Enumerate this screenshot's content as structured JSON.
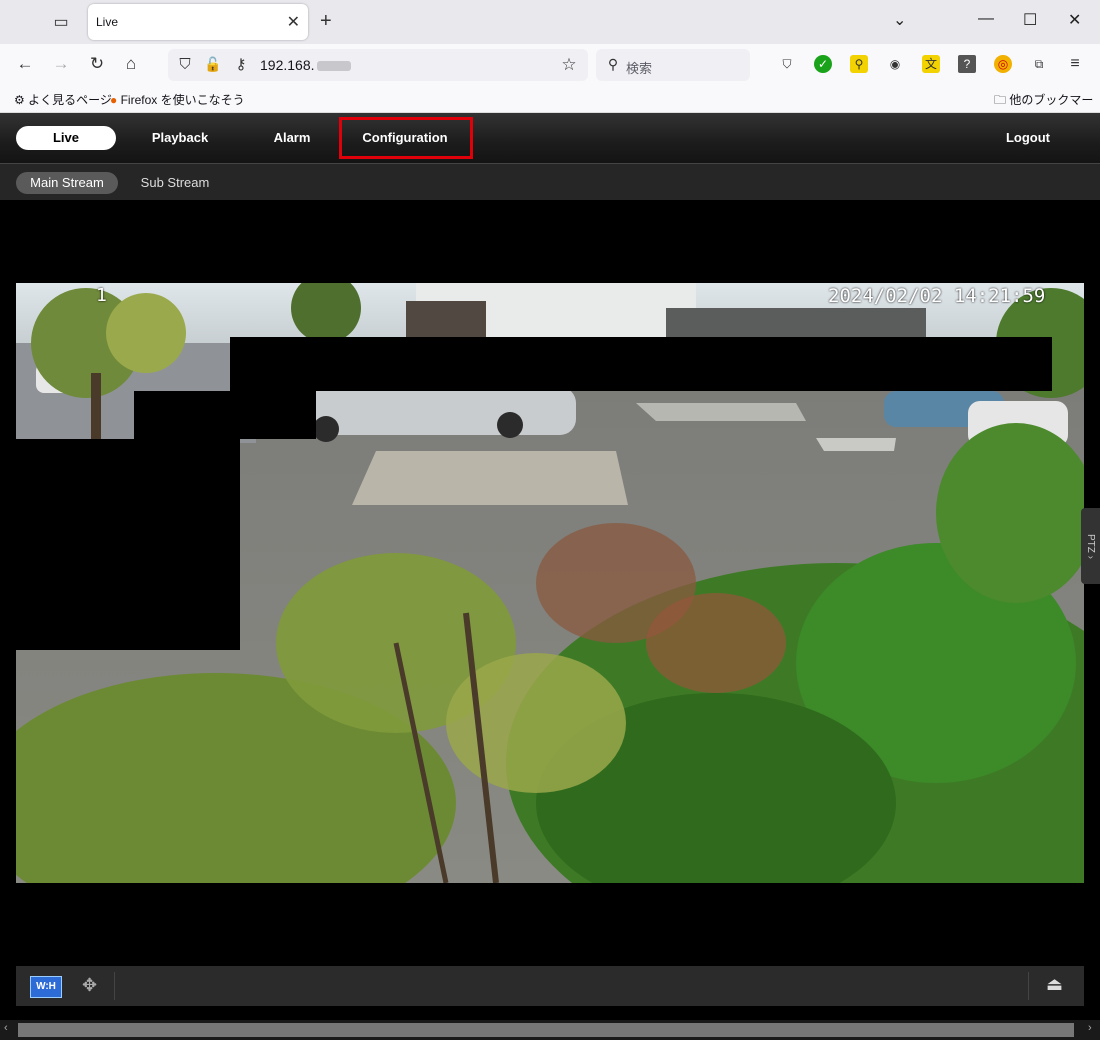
{
  "browser": {
    "tab_title": "Live",
    "tab_close": "✕",
    "new_tab": "+",
    "url": "192.168.",
    "search_placeholder": "検索",
    "bookmarks": [
      "よく見るページ",
      "Firefox を使いこなそう"
    ],
    "other_bookmarks": "他のブックマーク"
  },
  "camera_nav": {
    "items": [
      "Live",
      "Playback",
      "Alarm",
      "Configuration"
    ],
    "logout": "Logout",
    "highlighted": "Configuration"
  },
  "streams": {
    "main": "Main Stream",
    "sub": "Sub Stream"
  },
  "video": {
    "channel": "1",
    "timestamp": "2024/02/02 14:21:59"
  },
  "ptz_label": "PTZ",
  "toolbar": {
    "wh_label": "W:H"
  },
  "colors": {
    "highlight": "#e0000a",
    "accent": "#2d6bd6"
  }
}
